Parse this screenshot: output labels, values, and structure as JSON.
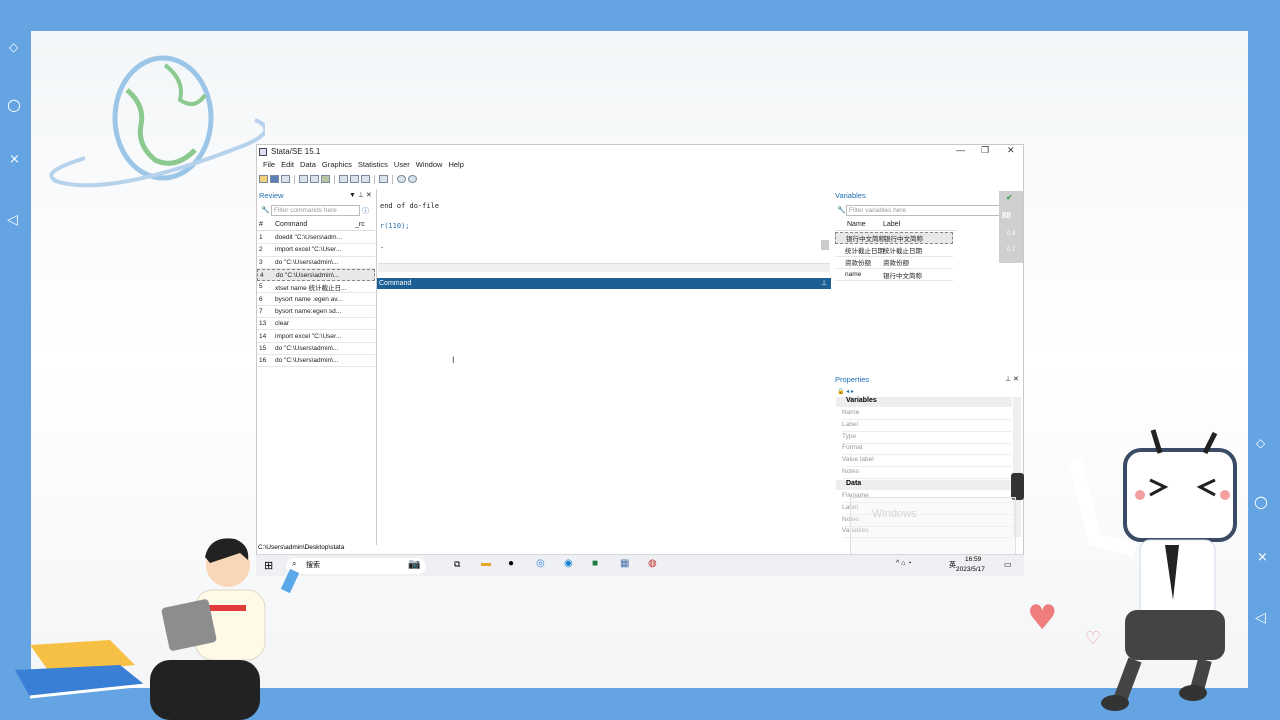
{
  "window": {
    "title": "Stata/SE 15.1",
    "minimize": "—",
    "restore": "❐",
    "close": "✕"
  },
  "menu": [
    "File",
    "Edit",
    "Data",
    "Graphics",
    "Statistics",
    "User",
    "Window",
    "Help"
  ],
  "review": {
    "title": "Review",
    "filter_placeholder": "Filter commands here",
    "headers": {
      "num": "#",
      "command": "Command",
      "rc": "_rc"
    },
    "rows": [
      {
        "num": "1",
        "command": "doedit \"C:\\Users\\adm..."
      },
      {
        "num": "2",
        "command": "import excel \"C:\\User..."
      },
      {
        "num": "3",
        "command": "do \"C:\\Users\\admin\\..."
      },
      {
        "num": "4",
        "command": "do \"C:\\Users\\admin\\..."
      },
      {
        "num": "5",
        "command": "xtset name 统计截止日..."
      },
      {
        "num": "6",
        "command": "bysort name :egen av..."
      },
      {
        "num": "7",
        "command": "bysort name:egen sd..."
      },
      {
        "num": "13",
        "command": "clear"
      },
      {
        "num": "14",
        "command": "import excel \"C:\\User..."
      },
      {
        "num": "15",
        "command": "do \"C:\\Users\\admin\\..."
      },
      {
        "num": "16",
        "command": "do \"C:\\Users\\admin\\..."
      }
    ]
  },
  "results": {
    "line1": "end of do-file",
    "line2": "r(110);",
    "line3": "."
  },
  "command_label": "Command",
  "variables": {
    "title": "Variables",
    "filter_placeholder": "Filter variables here",
    "headers": {
      "name": "Name",
      "label": "Label"
    },
    "rows": [
      {
        "name": "银行中文简称",
        "label": "银行中文简称"
      },
      {
        "name": "统计截止日期",
        "label": "统计截止日期"
      },
      {
        "name": "资款份额",
        "label": "资款份额"
      },
      {
        "name": "name",
        "label": "银行中文简称"
      }
    ]
  },
  "properties": {
    "title": "Properties",
    "section_variables": "Variables",
    "var_fields": [
      "Name",
      "Label",
      "Type",
      "Format",
      "Value label",
      "Notes"
    ],
    "section_data": "Data",
    "data_fields": [
      "Filename",
      "Label",
      "Notes",
      "Variables"
    ]
  },
  "status_path": "C:\\Users\\admin\\Desktop\\stata",
  "taskbar": {
    "search": "搜索",
    "ime": "英",
    "time": "16:59",
    "date": "2023/5/17"
  },
  "watermark": "Windows",
  "perf": {
    "score": "88",
    "v1": "0.4",
    "v2": "0.7"
  },
  "colors": {
    "background": "#64a4e2",
    "command_bar": "#1c5f95",
    "accent": "#1e6fb3"
  }
}
